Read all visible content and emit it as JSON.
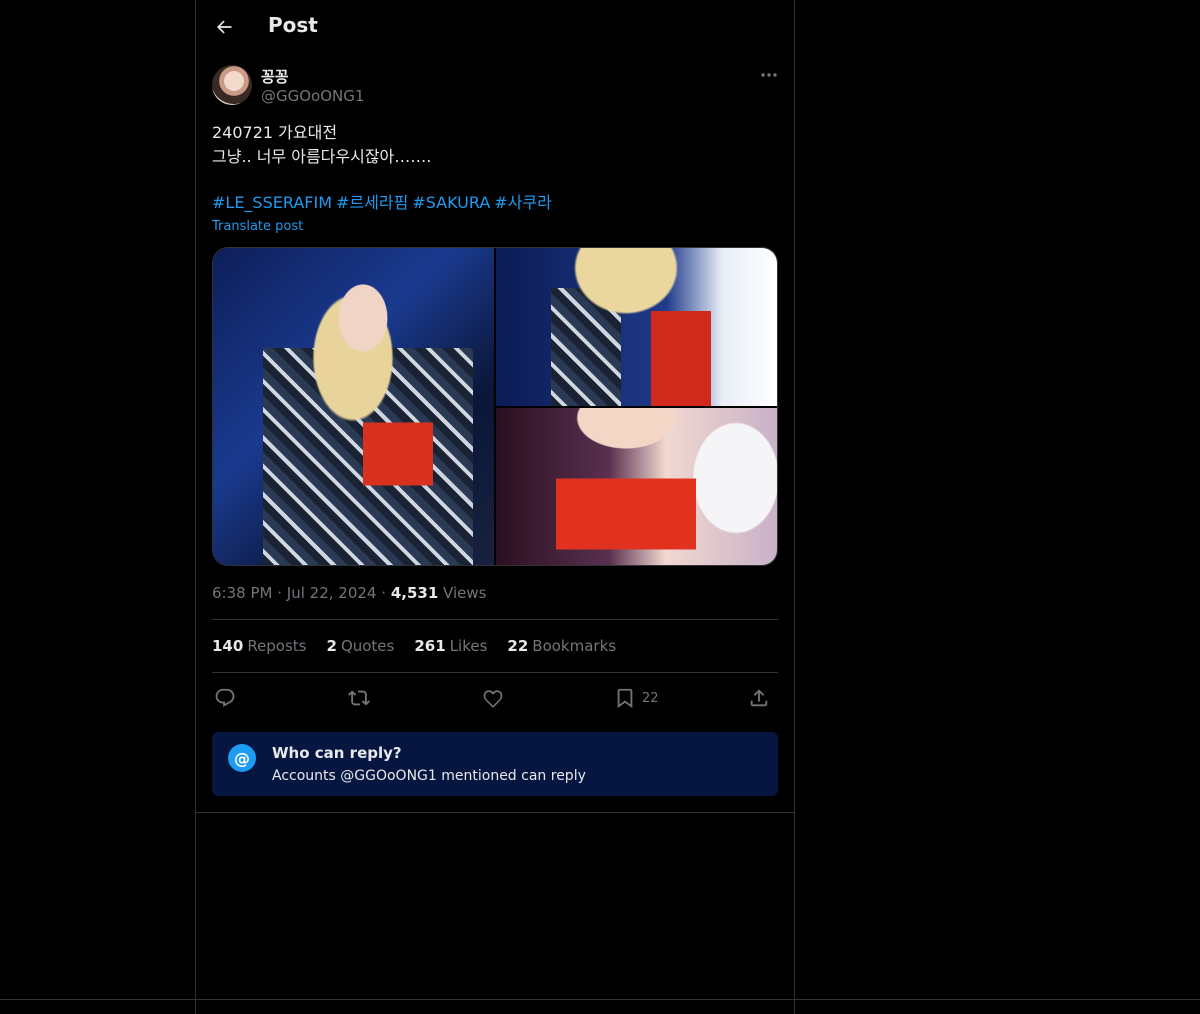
{
  "header": {
    "title": "Post",
    "back_icon": "arrow-left-icon"
  },
  "author": {
    "display_name": "꽁꽁",
    "handle": "@GGOoONG1",
    "more_icon": "more-horizontal-icon"
  },
  "post": {
    "text": "240721 가요대전\n그냥.. 너무 아름다우시잖아…….",
    "hashtags": [
      "#LE_SSERAFIM",
      "#르세라핌",
      "#SAKURA",
      "#사쿠라"
    ],
    "translate_label": "Translate post"
  },
  "media": {
    "image_count": 3
  },
  "meta": {
    "time": "6:38 PM",
    "date": "Jul 22, 2024",
    "views_count": "4,531",
    "views_label": "Views",
    "dot": "·"
  },
  "stats": {
    "reposts_count": "140",
    "reposts_label": "Reposts",
    "quotes_count": "2",
    "quotes_label": "Quotes",
    "likes_count": "261",
    "likes_label": "Likes",
    "bookmarks_count": "22",
    "bookmarks_label": "Bookmarks"
  },
  "actions": {
    "reply_icon": "reply-icon",
    "repost_icon": "repost-icon",
    "like_icon": "heart-icon",
    "bookmark_icon": "bookmark-icon",
    "bookmark_count": "22",
    "share_icon": "share-icon"
  },
  "reply_restriction": {
    "icon": "@",
    "title": "Who can reply?",
    "subtitle": "Accounts @GGOoONG1 mentioned can reply"
  },
  "colors": {
    "accent": "#1d9bf0",
    "background": "#000000",
    "reply_box_bg": "#061640",
    "border": "#2f3336",
    "muted": "#71767b"
  }
}
